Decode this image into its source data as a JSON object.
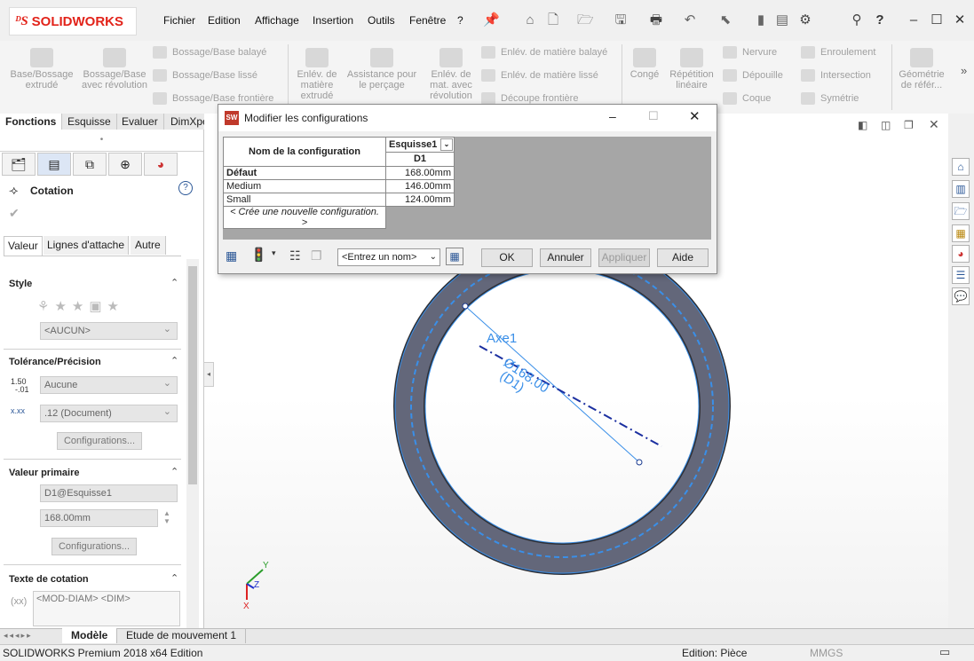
{
  "app": {
    "brand": "SOLIDWORKS"
  },
  "menu": [
    "Fichier",
    "Edition",
    "Affichage",
    "Insertion",
    "Outils",
    "Fenêtre",
    "?"
  ],
  "ribbon": {
    "big1": [
      "Base/Bossage extrudé",
      "Bossage/Base avec révolution"
    ],
    "small1": [
      "Bossage/Base balayé",
      "Bossage/Base lissé",
      "Bossage/Base frontière"
    ],
    "big2": [
      "Enlév. de matière extrudé",
      "Assistance pour le perçage",
      "Enlév. de mat. avec révolution"
    ],
    "small2": [
      "Enlév. de matière balayé",
      "Enlév. de matière lissé",
      "Découpe frontière"
    ],
    "big3": [
      "Congé",
      "Répétition linéaire"
    ],
    "small3": [
      "Nervure",
      "Dépouille",
      "Coque"
    ],
    "small4": [
      "Enroulement",
      "Intersection",
      "Symétrie"
    ],
    "big4": "Géométrie de référ..."
  },
  "command_tabs": [
    "Fonctions",
    "Esquisse",
    "Evaluer",
    "DimXpert"
  ],
  "panel": {
    "title": "Cotation",
    "subtabs": [
      "Valeur",
      "Lignes d'attache",
      "Autre"
    ],
    "style_head": "Style",
    "style_value": "<AUCUN>",
    "tol_head": "Tolérance/Précision",
    "tol_value": "Aucune",
    "prec_value": ".12 (Document)",
    "config_btn": "Configurations...",
    "primary_head": "Valeur primaire",
    "primary_name": "D1@Esquisse1",
    "primary_value": "168.00mm",
    "text_head": "Texte de cotation",
    "text_value": "<MOD-DIAM> <DIM>"
  },
  "dialog": {
    "title": "Modifier les configurations",
    "col_header": "Nom de la configuration",
    "sketch": "Esquisse1",
    "dim": "D1",
    "rows": [
      {
        "name": "Défaut",
        "value": "168.00mm"
      },
      {
        "name": "Medium",
        "value": "146.00mm"
      },
      {
        "name": "Small",
        "value": "124.00mm"
      }
    ],
    "new_row": "< Crée une nouvelle configuration. >",
    "name_select": "<Entrez un nom>",
    "ok": "OK",
    "cancel": "Annuler",
    "apply": "Appliquer",
    "help": "Aide"
  },
  "viewport": {
    "axis_label": "Axe1",
    "dim_text": "Ø168.00",
    "dim_sub": "(D1)",
    "triad": [
      "Y",
      "Z",
      "X"
    ]
  },
  "bottom_tabs": [
    "Modèle",
    "Etude de mouvement 1"
  ],
  "status": {
    "left": "SOLIDWORKS Premium 2018 x64 Edition",
    "mode": "Edition: Pièce",
    "units": "MMGS"
  },
  "colors": {
    "accent": "#e2231a",
    "sketch": "#3a8fe8",
    "part": "#5c5f6b"
  }
}
